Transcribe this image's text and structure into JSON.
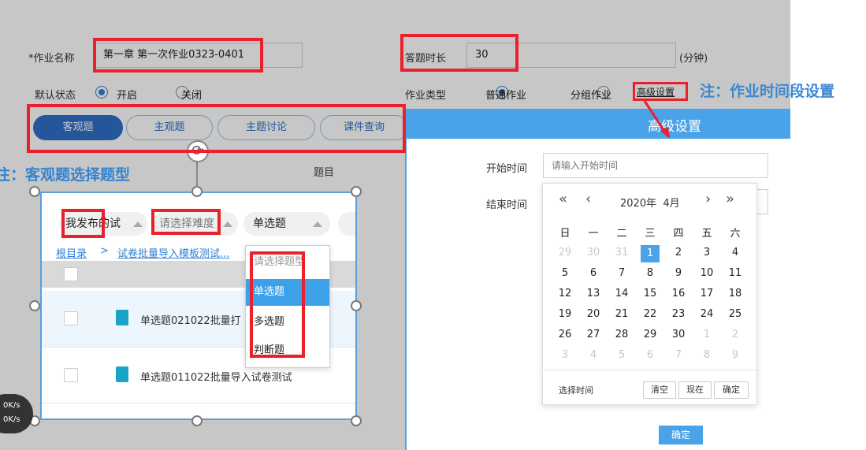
{
  "form": {
    "name_label": "*作业名称",
    "name_value": "第一章 第一次作业0323-0401",
    "duration_label": "答题时长",
    "duration_value": "30",
    "duration_unit": "(分钟)",
    "default_status_label": "默认状态",
    "status_open": "开启",
    "status_closed": "关闭",
    "type_label": "作业类型",
    "type_normal": "普通作业",
    "type_group": "分组作业",
    "advanced_link": "高级设置"
  },
  "tabs": [
    "客观题",
    "主观题",
    "主题讨论",
    "课件查询"
  ],
  "column_header": "题目",
  "notes": {
    "objective": "注：客观题选择题型",
    "time_period": "注：作业时间段设置"
  },
  "popup": {
    "filter_mine": "我发布的试",
    "filter_difficulty": "请选择难度",
    "filter_type": "单选题",
    "breadcrumb_root": "根目录",
    "breadcrumb_sep": ">",
    "breadcrumb_folder": "试卷批量导入模板测试...",
    "rows": [
      "单选题021022批量打",
      "单选题011022批量导入试卷测试"
    ],
    "dropdown": {
      "placeholder": "请选择题型",
      "options": [
        "单选题",
        "多选题",
        "判断题"
      ],
      "selected": "单选题"
    }
  },
  "advanced": {
    "title": "高级设置",
    "start_label": "开始时间",
    "start_placeholder": "请输入开始时间",
    "end_label": "结束时间",
    "confirm": "确定"
  },
  "calendar": {
    "nav_prev_year": "«",
    "nav_prev_month": "‹",
    "nav_next_month": "›",
    "nav_next_year": "»",
    "month_label": "2020年  4月",
    "weekdays": [
      "日",
      "一",
      "二",
      "三",
      "四",
      "五",
      "六"
    ],
    "weeks": [
      [
        "29",
        "30",
        "31",
        "1",
        "2",
        "3",
        "4"
      ],
      [
        "5",
        "6",
        "7",
        "8",
        "9",
        "10",
        "11"
      ],
      [
        "12",
        "13",
        "14",
        "15",
        "16",
        "17",
        "18"
      ],
      [
        "19",
        "20",
        "21",
        "22",
        "23",
        "24",
        "25"
      ],
      [
        "26",
        "27",
        "28",
        "29",
        "30",
        "1",
        "2"
      ],
      [
        "3",
        "4",
        "5",
        "6",
        "7",
        "8",
        "9"
      ]
    ],
    "selected_day": "1",
    "select_time": "选择时间",
    "clear": "清空",
    "now": "现在",
    "ok": "确定"
  },
  "speed": [
    "0K/s",
    "0K/s"
  ],
  "colors": {
    "accent": "#4aa3e8",
    "highlight": "#e8212b",
    "note": "#3d88d2"
  }
}
